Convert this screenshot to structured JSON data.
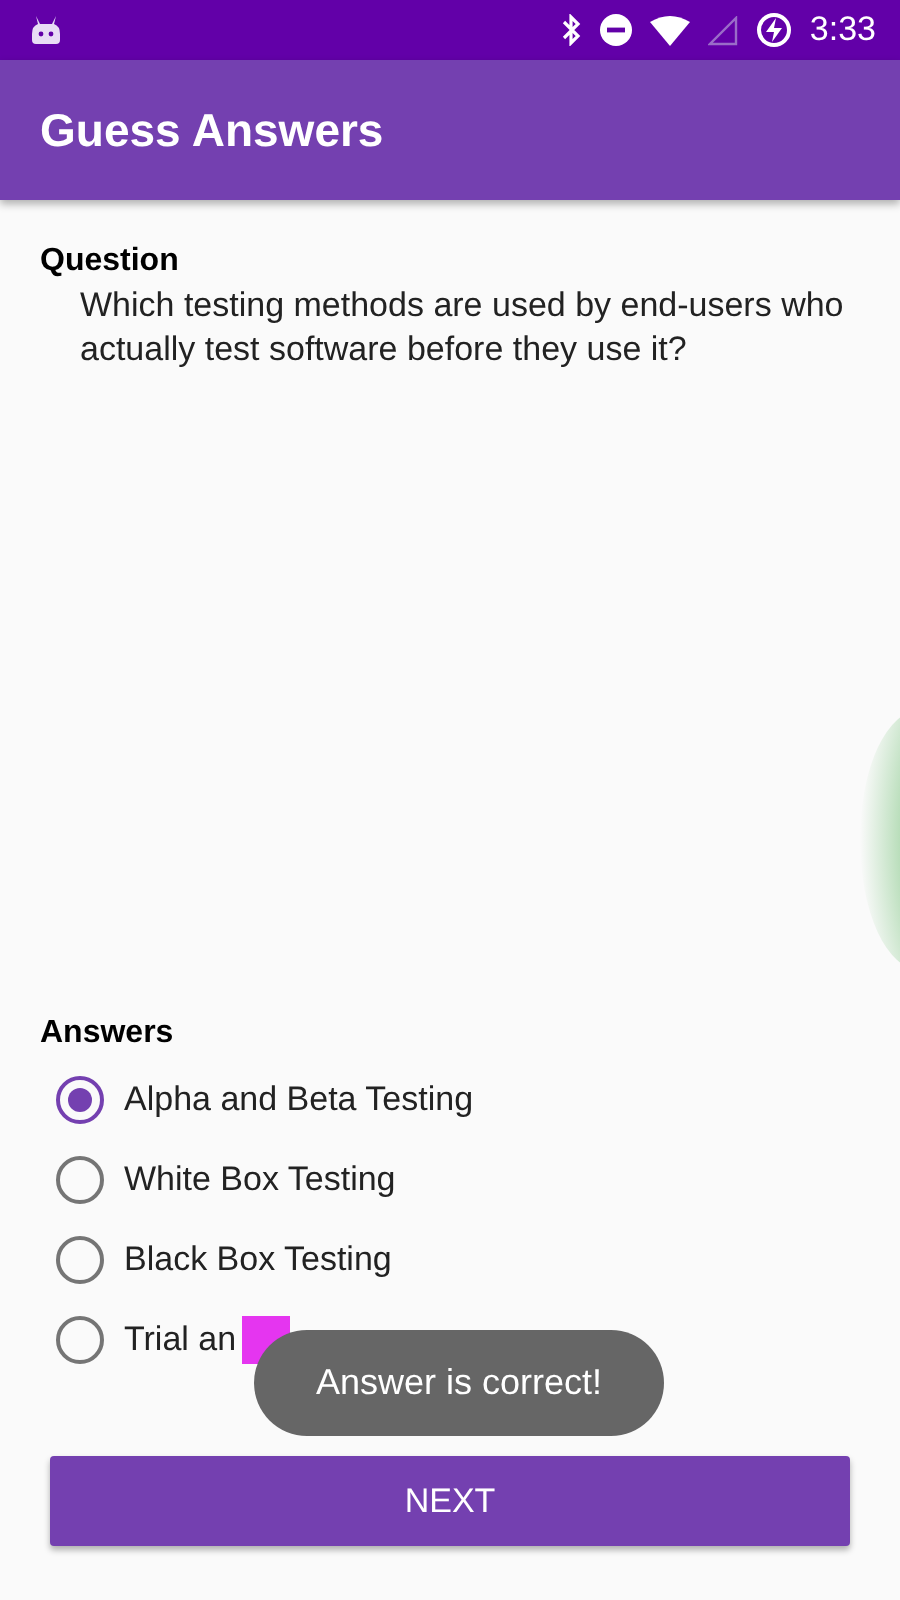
{
  "status_bar": {
    "time": "3:33"
  },
  "app_bar": {
    "title": "Guess Answers"
  },
  "question": {
    "label": "Question",
    "text": "Which testing methods are used by end-users who actually test software before they use it?"
  },
  "answers": {
    "label": "Answers",
    "options": [
      {
        "label": "Alpha and Beta Testing",
        "selected": true
      },
      {
        "label": "White Box Testing",
        "selected": false
      },
      {
        "label": "Black Box Testing",
        "selected": false
      },
      {
        "label": "Trial an",
        "selected": false
      }
    ]
  },
  "next_button": {
    "label": "NEXT"
  },
  "toast": {
    "text": "Answer is correct!"
  }
}
